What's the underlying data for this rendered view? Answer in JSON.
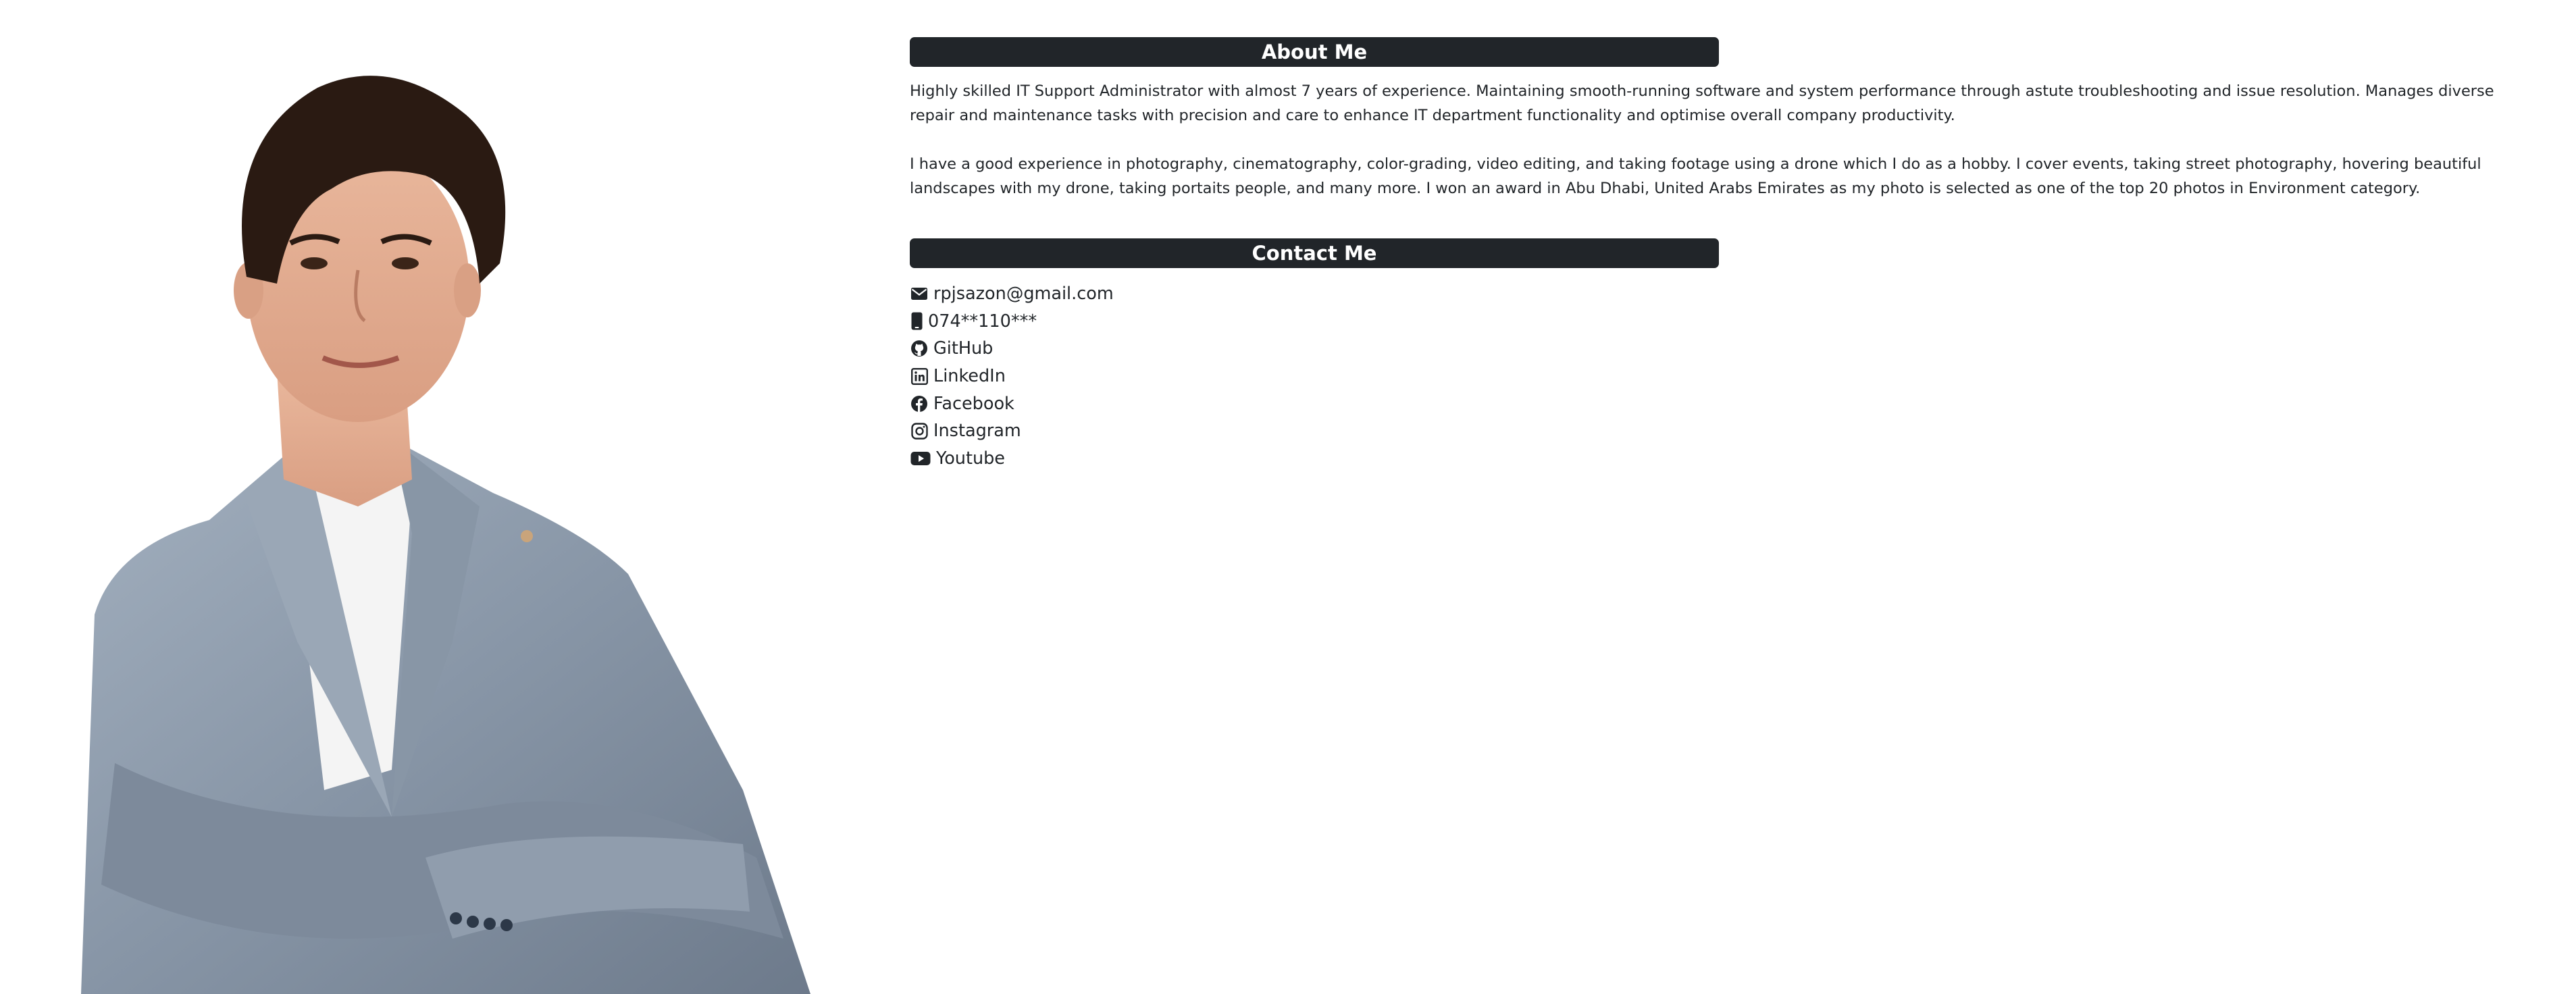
{
  "about": {
    "heading": "About Me",
    "paragraphs": [
      "Highly skilled IT Support Administrator with almost 7 years of experience. Maintaining smooth-running software and system performance through astute troubleshooting and issue resolution. Manages diverse repair and maintenance tasks with precision and care to enhance IT department functionality and optimise overall company productivity.",
      "I have a good experience in photography, cinematography, color-grading, video editing, and taking footage using a drone which I do as a hobby. I cover events, taking street photography, hovering beautiful landscapes with my drone, taking portaits people, and many more. I won an award in Abu Dhabi, United Arabs Emirates as my photo is selected as one of the top 20 photos in Environment category."
    ]
  },
  "contact": {
    "heading": "Contact Me",
    "items": [
      {
        "icon": "envelope-icon",
        "label": "rpjsazon@gmail.com"
      },
      {
        "icon": "mobile-phone-icon",
        "label": "074**110***"
      },
      {
        "icon": "github-icon",
        "label": "GitHub"
      },
      {
        "icon": "linkedin-icon",
        "label": "LinkedIn"
      },
      {
        "icon": "facebook-icon",
        "label": "Facebook"
      },
      {
        "icon": "instagram-icon",
        "label": "Instagram"
      },
      {
        "icon": "youtube-icon",
        "label": "Youtube"
      }
    ]
  },
  "colors": {
    "header_bg": "#212529",
    "header_text": "#ffffff",
    "body_text": "#212529",
    "page_bg": "#ffffff"
  }
}
